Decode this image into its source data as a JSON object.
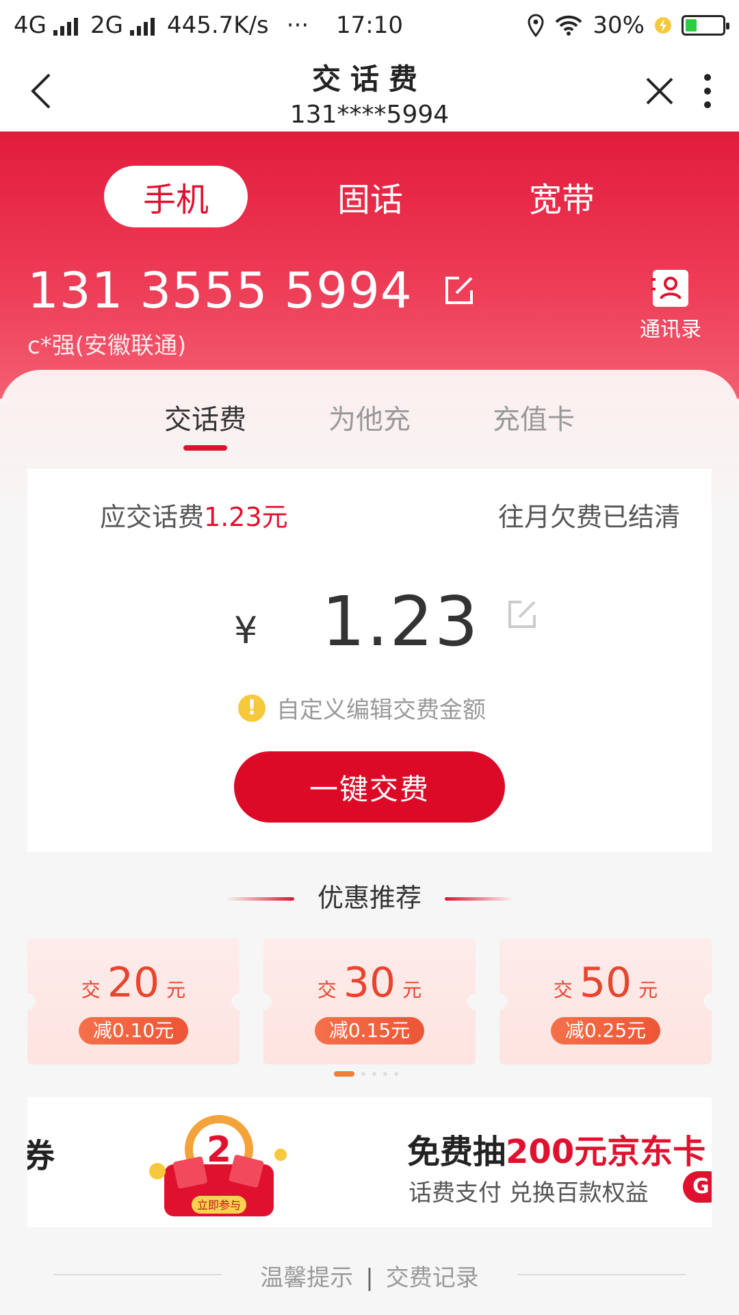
{
  "status_bar": {
    "network1": "4G",
    "network2": "2G",
    "speed": "445.7K/s",
    "more": "···",
    "time": "17:10",
    "battery_pct": "30%",
    "battery_level": 0.3
  },
  "nav": {
    "title": "交话费",
    "subtitle": "131****5994"
  },
  "top_tabs": [
    {
      "label": "手机",
      "active": true
    },
    {
      "label": "固话",
      "active": false
    },
    {
      "label": "宽带",
      "active": false
    }
  ],
  "account": {
    "phone": "131 3555 5994",
    "owner": "c*强(安徽联通)",
    "contacts_label": "通讯录"
  },
  "sub_tabs": [
    {
      "label": "交话费",
      "active": true
    },
    {
      "label": "为他充",
      "active": false
    },
    {
      "label": "充值卡",
      "active": false
    }
  ],
  "payment": {
    "due_label": "应交话费",
    "due_amount": "1.23元",
    "arrears_status": "往月欠费已结清",
    "currency_symbol": "¥",
    "amount": "1.23",
    "hint_icon": "!",
    "hint": "自定义编辑交费金额",
    "pay_button": "一键交费"
  },
  "recommend": {
    "title": "优惠推荐",
    "coupons": [
      {
        "prefix": "交",
        "value": "20",
        "unit": "元",
        "discount": "减0.10元"
      },
      {
        "prefix": "交",
        "value": "30",
        "unit": "元",
        "discount": "减0.15元"
      },
      {
        "prefix": "交",
        "value": "50",
        "unit": "元",
        "discount": "减0.25元"
      }
    ],
    "page_count": 5,
    "active_page": 1
  },
  "banner": {
    "edge_text": "券",
    "art_number": "2",
    "art_button": "立即参与",
    "title_prefix": "免费抽",
    "title_highlight": "200元京东卡",
    "subtitle": "话费支付 兑换百款权益",
    "pill": "G"
  },
  "footer": {
    "tips": "温馨提示",
    "separator": "|",
    "records": "交费记录"
  },
  "colors": {
    "brand_red": "#e0112e",
    "coupon_orange": "#e8442e",
    "hint_yellow": "#f6c83b"
  }
}
